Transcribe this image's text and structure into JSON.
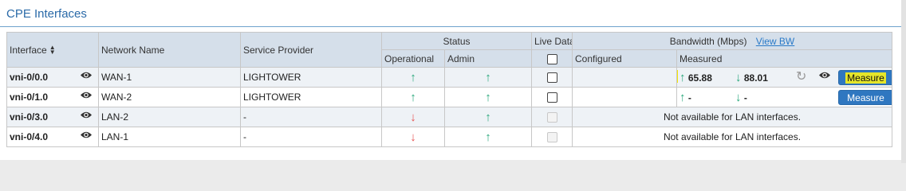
{
  "panel": {
    "title": "CPE Interfaces"
  },
  "colors": {
    "accent": "#2a6aa8",
    "up": "#28a77a",
    "down": "#e65252",
    "button": "#2f77c0",
    "highlight": "#f5e600"
  },
  "headers": {
    "interface": "Interface",
    "network_name": "Network Name",
    "service_provider": "Service Provider",
    "status": "Status",
    "operational": "Operational",
    "admin": "Admin",
    "live_data": "Live Data",
    "bandwidth": "Bandwidth (Mbps)",
    "view_bw": "View BW",
    "configured": "Configured",
    "measured": "Measured"
  },
  "rows": [
    {
      "interface": "vni-0/0.0",
      "network": "WAN-1",
      "provider": "LIGHTOWER",
      "operational": "up",
      "admin": "up",
      "live_checked": false,
      "live_disabled": false,
      "configured": "",
      "measured_up": "65.88",
      "measured_down": "88.01",
      "wan": true,
      "button": "Measure"
    },
    {
      "interface": "vni-0/1.0",
      "network": "WAN-2",
      "provider": "LIGHTOWER",
      "operational": "up",
      "admin": "up",
      "live_checked": false,
      "live_disabled": false,
      "configured": "",
      "measured_up": "-",
      "measured_down": "-",
      "wan": true,
      "button": "Measure"
    },
    {
      "interface": "vni-0/3.0",
      "network": "LAN-2",
      "provider": "-",
      "operational": "down",
      "admin": "up",
      "live_checked": false,
      "live_disabled": true,
      "na": "Not available for LAN interfaces."
    },
    {
      "interface": "vni-0/4.0",
      "network": "LAN-1",
      "provider": "-",
      "operational": "down",
      "admin": "up",
      "live_checked": false,
      "live_disabled": true,
      "na": "Not available for LAN interfaces."
    }
  ],
  "icons": {
    "eye": "eye-icon",
    "sort": "sort-icon",
    "up": "arrow-up-icon",
    "down": "arrow-down-icon",
    "refresh": "refresh-icon"
  }
}
